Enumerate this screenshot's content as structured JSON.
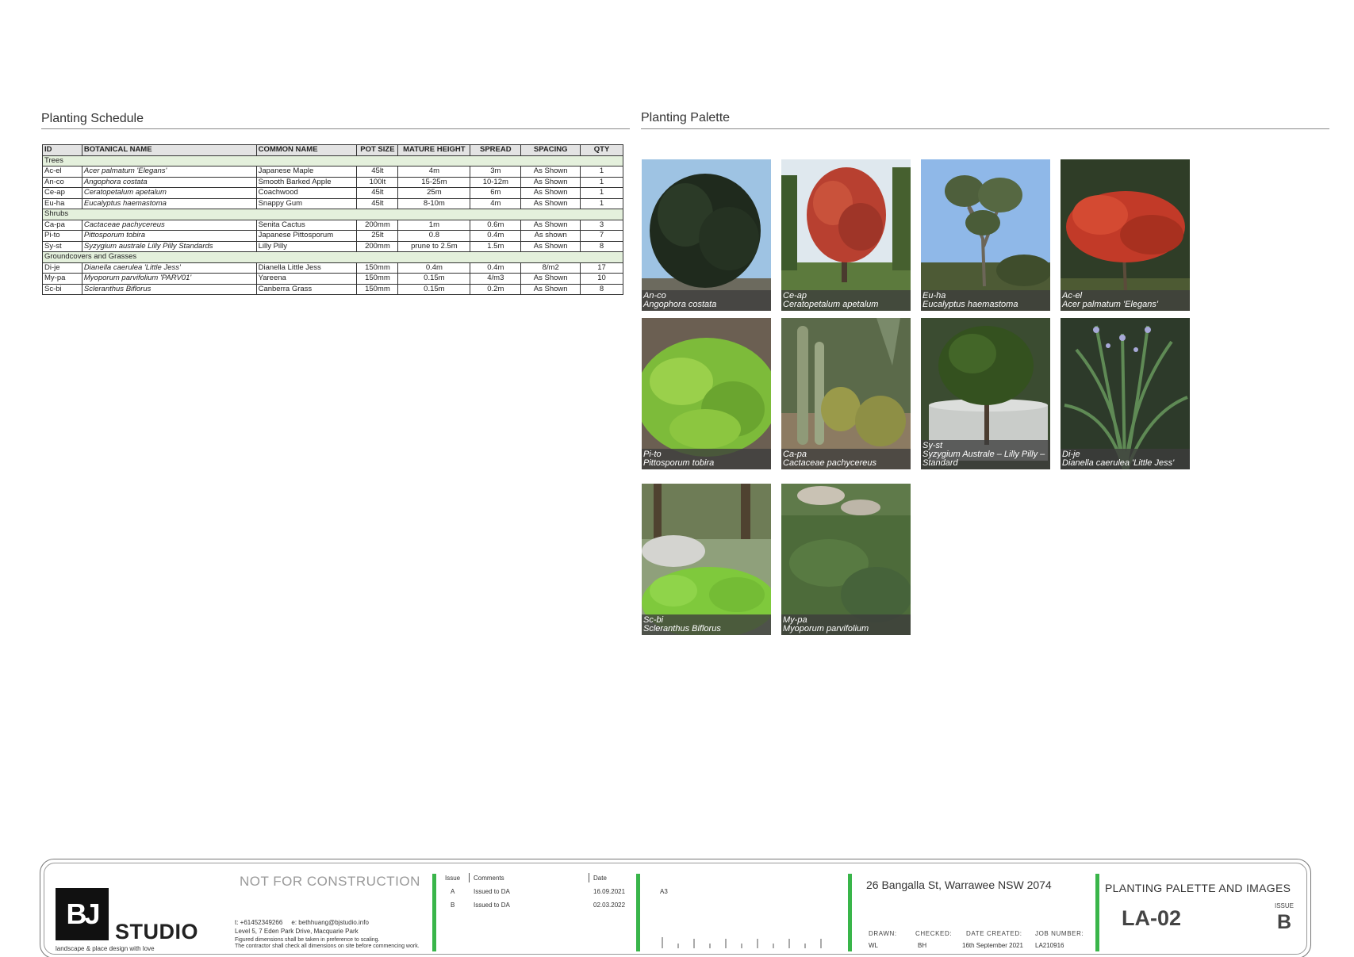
{
  "schedule": {
    "heading": "Planting Schedule",
    "columns": [
      "ID",
      "BOTANICAL NAME",
      "COMMON NAME",
      "POT SIZE",
      "MATURE HEIGHT",
      "SPREAD",
      "SPACING",
      "QTY"
    ],
    "groups": [
      {
        "name": "Trees",
        "rows": [
          [
            "Ac-el",
            "Acer palmatum 'Elegans'",
            "Japanese Maple",
            "45lt",
            "4m",
            "3m",
            "As Shown",
            "1"
          ],
          [
            "An-co",
            "Angophora costata",
            "Smooth Barked Apple",
            "100lt",
            "15-25m",
            "10-12m",
            "As Shown",
            "1"
          ],
          [
            "Ce-ap",
            "Ceratopetalum apetalum",
            "Coachwood",
            "45lt",
            "25m",
            "6m",
            "As Shown",
            "1"
          ],
          [
            "Eu-ha",
            "Eucalyptus haemastoma",
            "Snappy Gum",
            "45lt",
            "8-10m",
            "4m",
            "As Shown",
            "1"
          ]
        ]
      },
      {
        "name": "Shrubs",
        "rows": [
          [
            "Ca-pa",
            "Cactaceae pachycereus",
            "Senita Cactus",
            "200mm",
            "1m",
            "0.6m",
            "As Shown",
            "3"
          ],
          [
            "Pi-to",
            "Pittosporum tobira",
            "Japanese Pittosporum",
            "25lt",
            "0.8",
            "0.4m",
            "As shown",
            "7"
          ],
          [
            "Sy-st",
            "Syzygium australe Lilly Pilly Standards",
            "Lilly Pilly",
            "200mm",
            "prune to 2.5m",
            "1.5m",
            "As Shown",
            "8"
          ]
        ]
      },
      {
        "name": "Groundcovers and Grasses",
        "rows": [
          [
            "Di-je",
            "Dianella caerulea 'Little Jess'",
            "Dianella Little Jess",
            "150mm",
            "0.4m",
            "0.4m",
            "8/m2",
            "17"
          ],
          [
            "My-pa",
            "Myoporum parvifolium 'PARV01'",
            "Yareena",
            "150mm",
            "0.15m",
            "4/m3",
            "As Shown",
            "10"
          ],
          [
            "Sc-bi",
            "Scleranthus Biflorus",
            "Canberra Grass",
            "150mm",
            "0.15m",
            "0.2m",
            "As Shown",
            "8"
          ]
        ]
      }
    ]
  },
  "palette": {
    "heading": "Planting Palette",
    "items": [
      {
        "code": "An-co",
        "name": "Angophora costata",
        "image": "tree-dark-canopy"
      },
      {
        "code": "Ce-ap",
        "name": "Ceratopetalum apetalum",
        "image": "tree-red-flowering"
      },
      {
        "code": "Eu-ha",
        "name": "Eucalyptus haemastoma",
        "image": "tree-eucalyptus"
      },
      {
        "code": "Ac-el",
        "name": "Acer palmatum 'Elegans'",
        "image": "tree-red-maple"
      },
      {
        "code": "Pi-to",
        "name": "Pittosporum tobira",
        "image": "shrub-light-green"
      },
      {
        "code": "Ca-pa",
        "name": "Cactaceae pachycereus",
        "image": "cactus-garden"
      },
      {
        "code": "Sy-st",
        "name": "Syzygium Australe – Lilly Pilly – Standard",
        "image": "standard-in-planter"
      },
      {
        "code": "Di-je",
        "name": "Dianella caerulea 'Little Jess'",
        "image": "strappy-grass"
      },
      {
        "code": "Sc-bi",
        "name": "Scleranthus Biflorus",
        "image": "moss-mound"
      },
      {
        "code": "My-pa",
        "name": "Myoporum parvifolium",
        "image": "groundcover"
      }
    ]
  },
  "titleblock": {
    "logo_text": "BJ",
    "studio": "STUDIO",
    "tagline": "landscape & place design with love",
    "not_for_construction": "NOT FOR CONSTRUCTION",
    "phone_email": "t: +61452349266     e: bethhuang@bjstudio.info",
    "address_line": "Level 5, 7 Eden Park Drive, Macquarie Park",
    "note_1": "Figured dimensions shall be taken in preference to scaling.",
    "note_2": "The contractor shall check all dimensions on site before commencing work.",
    "issue_header": "Issue",
    "comments_header": "Comments",
    "date_header": "Date",
    "issues": [
      {
        "issue": "A",
        "comment": "Issued to DA",
        "date": "16.09.2021"
      },
      {
        "issue": "B",
        "comment": "Issued to DA",
        "date": "02.03.2022"
      }
    ],
    "sheet_size": "A3",
    "project_address": "26 Bangalla St, Warrawee NSW 2074",
    "drawn_label": "DRAWN:",
    "drawn": "WL",
    "checked_label": "CHECKED:",
    "checked": "BH",
    "date_created_label": "DATE CREATED:",
    "date_created": "16th September 2021",
    "job_number_label": "JOB NUMBER:",
    "job_number": "LA210916",
    "drawing_title": "PLANTING PALETTE AND IMAGES",
    "drawing_number": "LA-02",
    "issue_label": "ISSUE",
    "issue_value": "B"
  }
}
